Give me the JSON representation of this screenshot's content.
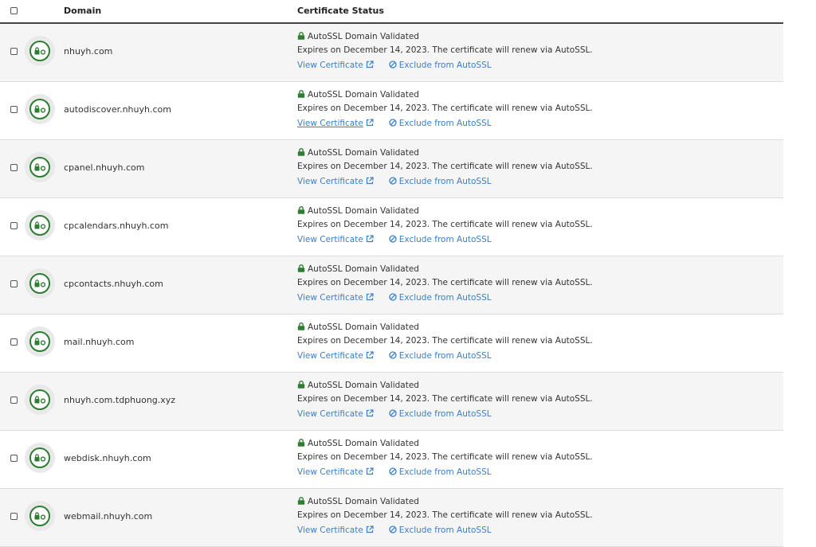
{
  "header": {
    "domain_label": "Domain",
    "status_label": "Certificate Status"
  },
  "colors": {
    "accent_link": "#3b7fc4",
    "valid_green": "#2e7d32"
  },
  "rows": [
    {
      "domain": "nhuyh.com",
      "status": "AutoSSL Domain Validated",
      "expiry": "Expires on December 14, 2023. The certificate will renew via AutoSSL.",
      "view_label": "View Certificate",
      "exclude_label": "Exclude from AutoSSL"
    },
    {
      "domain": "autodiscover.nhuyh.com",
      "status": "AutoSSL Domain Validated",
      "expiry": "Expires on December 14, 2023. The certificate will renew via AutoSSL.",
      "view_label": "View Certificate",
      "exclude_label": "Exclude from AutoSSL"
    },
    {
      "domain": "cpanel.nhuyh.com",
      "status": "AutoSSL Domain Validated",
      "expiry": "Expires on December 14, 2023. The certificate will renew via AutoSSL.",
      "view_label": "View Certificate",
      "exclude_label": "Exclude from AutoSSL"
    },
    {
      "domain": "cpcalendars.nhuyh.com",
      "status": "AutoSSL Domain Validated",
      "expiry": "Expires on December 14, 2023. The certificate will renew via AutoSSL.",
      "view_label": "View Certificate",
      "exclude_label": "Exclude from AutoSSL"
    },
    {
      "domain": "cpcontacts.nhuyh.com",
      "status": "AutoSSL Domain Validated",
      "expiry": "Expires on December 14, 2023. The certificate will renew via AutoSSL.",
      "view_label": "View Certificate",
      "exclude_label": "Exclude from AutoSSL"
    },
    {
      "domain": "mail.nhuyh.com",
      "status": "AutoSSL Domain Validated",
      "expiry": "Expires on December 14, 2023. The certificate will renew via AutoSSL.",
      "view_label": "View Certificate",
      "exclude_label": "Exclude from AutoSSL"
    },
    {
      "domain": "nhuyh.com.tdphuong.xyz",
      "status": "AutoSSL Domain Validated",
      "expiry": "Expires on December 14, 2023. The certificate will renew via AutoSSL.",
      "view_label": "View Certificate",
      "exclude_label": "Exclude from AutoSSL"
    },
    {
      "domain": "webdisk.nhuyh.com",
      "status": "AutoSSL Domain Validated",
      "expiry": "Expires on December 14, 2023. The certificate will renew via AutoSSL.",
      "view_label": "View Certificate",
      "exclude_label": "Exclude from AutoSSL"
    },
    {
      "domain": "webmail.nhuyh.com",
      "status": "AutoSSL Domain Validated",
      "expiry": "Expires on December 14, 2023. The certificate will renew via AutoSSL.",
      "view_label": "View Certificate",
      "exclude_label": "Exclude from AutoSSL"
    }
  ]
}
